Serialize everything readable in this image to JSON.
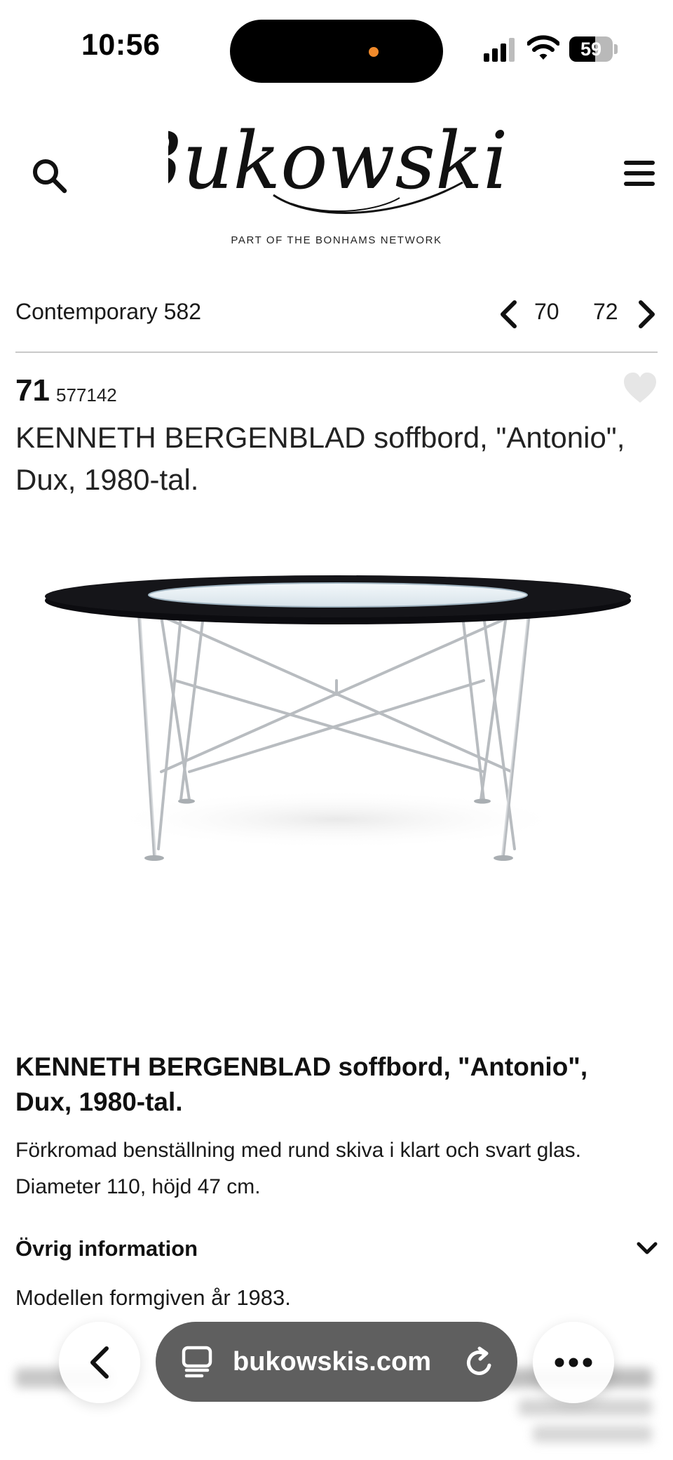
{
  "status_bar": {
    "time": "10:56",
    "battery_level": "59",
    "battery_fraction": 0.59
  },
  "header": {
    "logo_text": "Bukowskis",
    "tagline": "PART OF THE BONHAMS NETWORK"
  },
  "navigation": {
    "title": "Contemporary 582",
    "prev_lot": "70",
    "next_lot": "72"
  },
  "lot": {
    "number": "71",
    "id": "577142",
    "title": "KENNETH BERGENBLAD soffbord, \"Antonio\", Dux, 1980-tal."
  },
  "description": {
    "title": "KENNETH BERGENBLAD soffbord, \"Antonio\", Dux, 1980-tal.",
    "text": "Förkromad benställning med rund skiva i klart och svart glas. Diameter 110, höjd 47 cm."
  },
  "other_info": {
    "heading": "Övrig information",
    "text": "Modellen formgiven år 1983."
  },
  "browser": {
    "url": "bukowskis.com"
  },
  "colors": {
    "url_pill": "#5f5f5f",
    "island_dot": "#f08a2b"
  },
  "icons": [
    "search-icon",
    "menu-icon",
    "chevron-left-icon",
    "chevron-right-icon",
    "heart-icon",
    "chevron-down-icon",
    "back-icon",
    "tabs-icon",
    "reload-icon",
    "more-icon"
  ]
}
